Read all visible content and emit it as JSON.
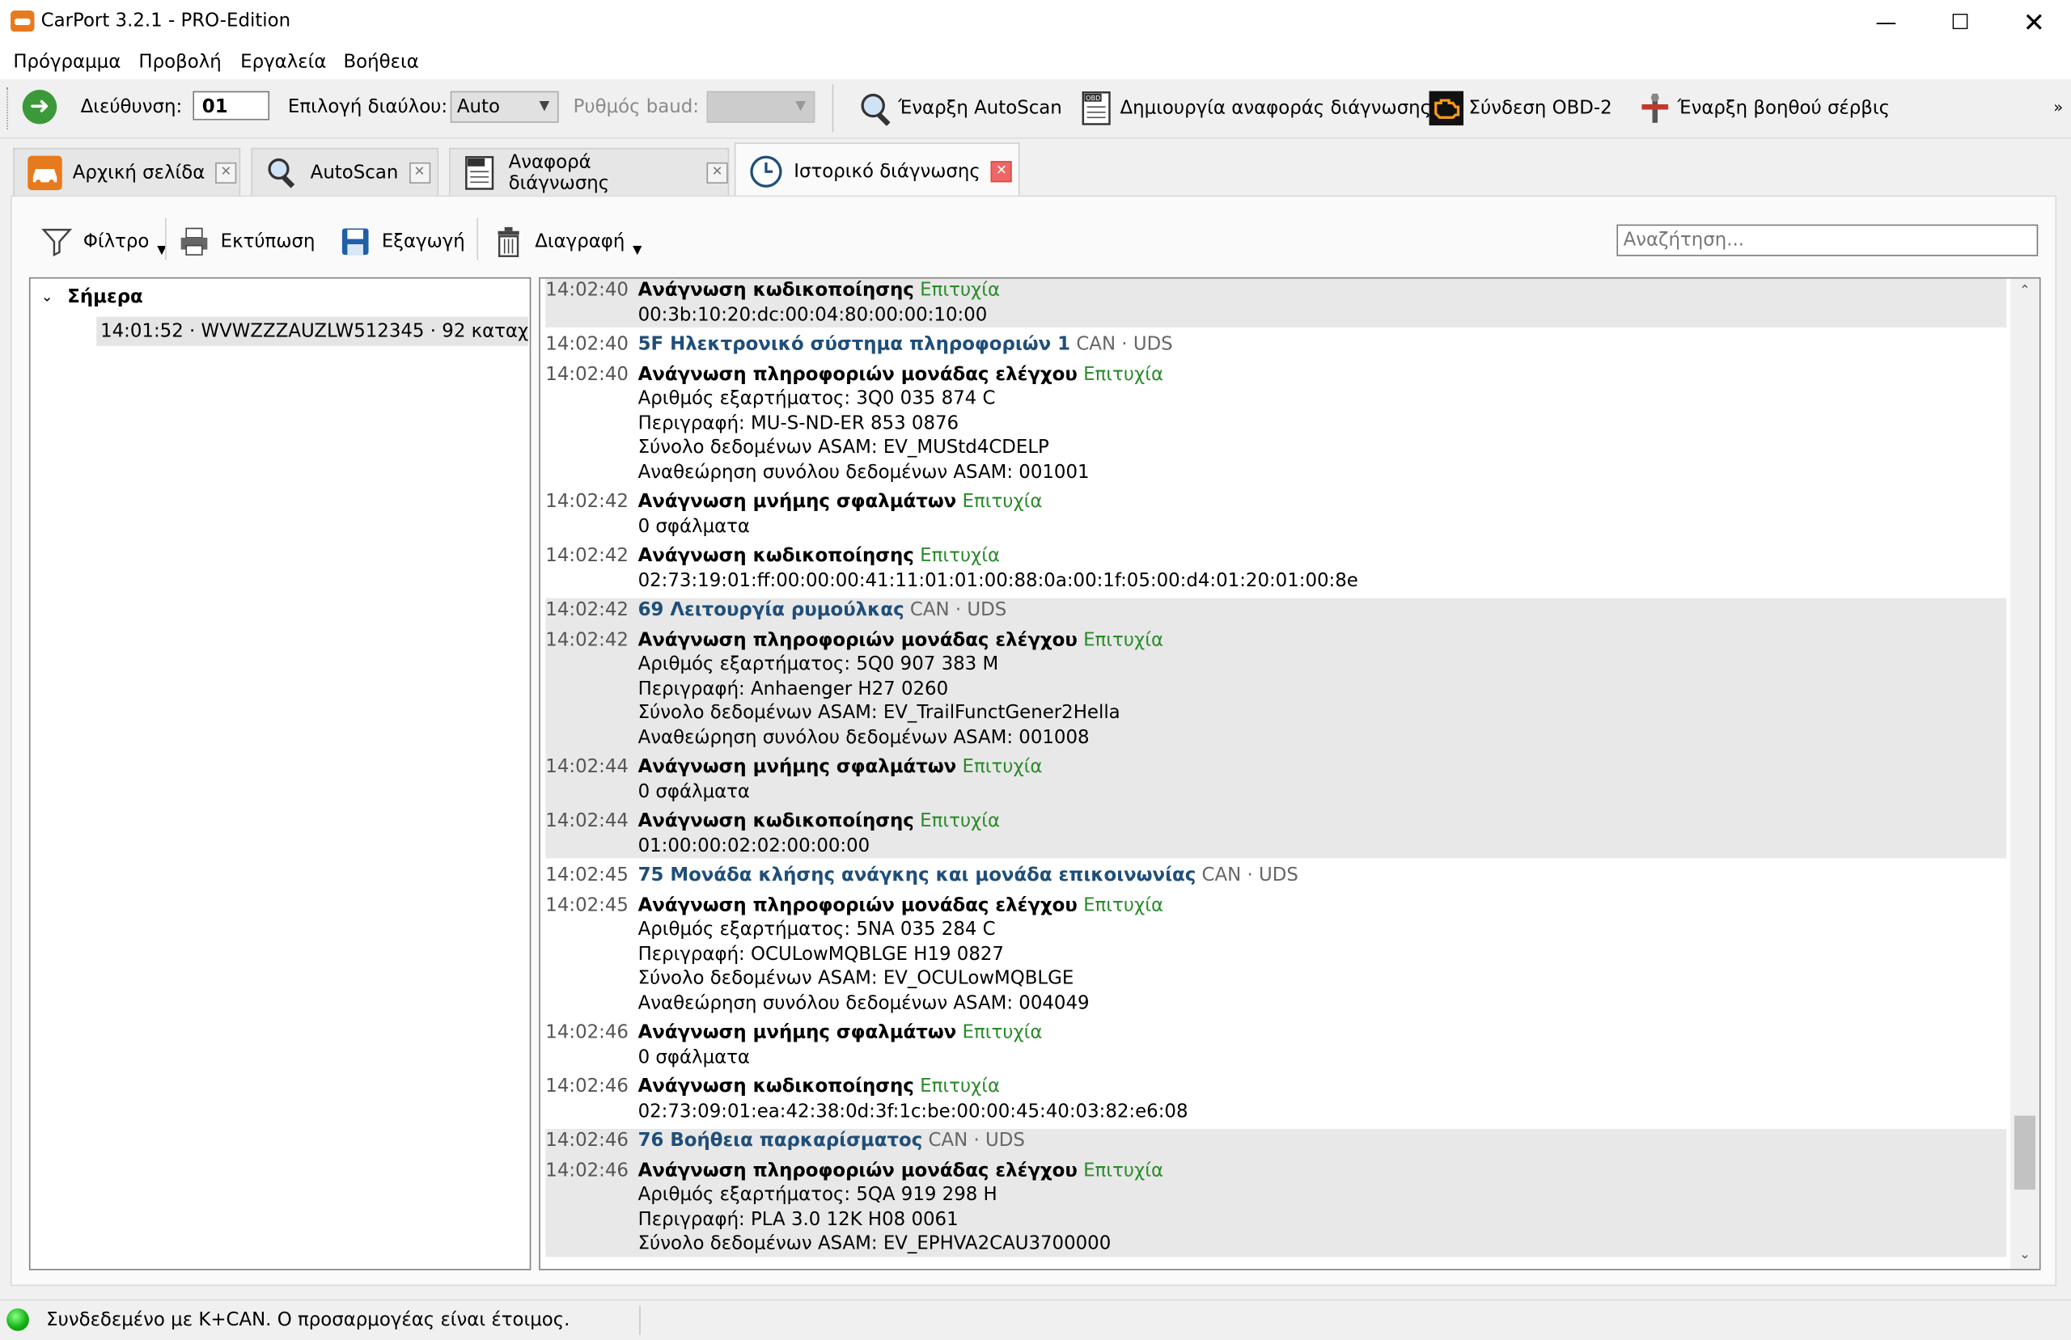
{
  "window": {
    "title": "CarPort 3.2.1 - PRO-Edition"
  },
  "menu": [
    "Πρόγραμμα",
    "Προβολή",
    "Εργαλεία",
    "Βοήθεια"
  ],
  "toolbar": {
    "address_label": "Διεύθυνση:",
    "address_value": "01",
    "bus_label": "Επιλογή διαύλου:",
    "bus_value": "Auto",
    "baud_label": "Ρυθμός baud:",
    "autoscan": "Έναρξη AutoScan",
    "report": "Δημιουργία αναφοράς διάγνωσης",
    "obd": "Σύνδεση OBD-2",
    "service": "Έναρξη βοηθού σέρβις",
    "overflow": "»"
  },
  "tabs": [
    {
      "label": "Αρχική σελίδα"
    },
    {
      "label": "AutoScan"
    },
    {
      "label": "Αναφορά διάγνωσης"
    },
    {
      "label": "Ιστορικό διάγνωσης"
    }
  ],
  "history_toolbar": {
    "filter": "Φίλτρο",
    "print": "Εκτύπωση",
    "export": "Εξαγωγή",
    "delete": "Διαγραφή",
    "search_placeholder": "Αναζήτηση..."
  },
  "tree": {
    "group": "Σήμερα",
    "item": "14:01:52 · WVWZZZAUZLW512345 · 92 καταχ..."
  },
  "log": [
    {
      "shade": true,
      "rows": [
        {
          "time": "14:02:40",
          "op": "Ανάγνωση κωδικοποίησης",
          "status": "Επιτυχία",
          "lines": [
            "00:3b:10:20:dc:00:04:80:00:00:10:00"
          ]
        }
      ]
    },
    {
      "shade": false,
      "rows": [
        {
          "time": "14:02:40",
          "module": "5F Ηλεκτρονικό σύστημα πληροφοριών 1",
          "proto": "CAN · UDS"
        },
        {
          "time": "14:02:40",
          "op": "Ανάγνωση πληροφοριών μονάδας ελέγχου",
          "status": "Επιτυχία",
          "lines": [
            "Αριθμός εξαρτήματος: 3Q0 035 874 C",
            "Περιγραφή: MU-S-ND-ER 853 0876",
            "Σύνολο δεδομένων ASAM: EV_MUStd4CDELP",
            "Αναθεώρηση συνόλου δεδομένων ASAM: 001001"
          ]
        },
        {
          "time": "14:02:42",
          "op": "Ανάγνωση μνήμης σφαλμάτων",
          "status": "Επιτυχία",
          "lines": [
            "0 σφάλματα"
          ]
        },
        {
          "time": "14:02:42",
          "op": "Ανάγνωση κωδικοποίησης",
          "status": "Επιτυχία",
          "lines": [
            "02:73:19:01:ff:00:00:00:41:11:01:01:00:88:0a:00:1f:05:00:d4:01:20:01:00:8e"
          ]
        }
      ]
    },
    {
      "shade": true,
      "rows": [
        {
          "time": "14:02:42",
          "module": "69 Λειτουργία ρυμούλκας",
          "proto": "CAN · UDS"
        },
        {
          "time": "14:02:42",
          "op": "Ανάγνωση πληροφοριών μονάδας ελέγχου",
          "status": "Επιτυχία",
          "lines": [
            "Αριθμός εξαρτήματος: 5Q0 907 383 M",
            "Περιγραφή: Anhaenger H27 0260",
            "Σύνολο δεδομένων ASAM: EV_TrailFunctGener2Hella",
            "Αναθεώρηση συνόλου δεδομένων ASAM: 001008"
          ]
        },
        {
          "time": "14:02:44",
          "op": "Ανάγνωση μνήμης σφαλμάτων",
          "status": "Επιτυχία",
          "lines": [
            "0 σφάλματα"
          ]
        },
        {
          "time": "14:02:44",
          "op": "Ανάγνωση κωδικοποίησης",
          "status": "Επιτυχία",
          "lines": [
            "01:00:00:02:02:00:00:00"
          ]
        }
      ]
    },
    {
      "shade": false,
      "rows": [
        {
          "time": "14:02:45",
          "module": "75 Μονάδα κλήσης ανάγκης και μονάδα επικοινωνίας",
          "proto": "CAN · UDS"
        },
        {
          "time": "14:02:45",
          "op": "Ανάγνωση πληροφοριών μονάδας ελέγχου",
          "status": "Επιτυχία",
          "lines": [
            "Αριθμός εξαρτήματος: 5NA 035 284 C",
            "Περιγραφή: OCULowMQBLGE H19 0827",
            "Σύνολο δεδομένων ASAM: EV_OCULowMQBLGE",
            "Αναθεώρηση συνόλου δεδομένων ASAM: 004049"
          ]
        },
        {
          "time": "14:02:46",
          "op": "Ανάγνωση μνήμης σφαλμάτων",
          "status": "Επιτυχία",
          "lines": [
            "0 σφάλματα"
          ]
        },
        {
          "time": "14:02:46",
          "op": "Ανάγνωση κωδικοποίησης",
          "status": "Επιτυχία",
          "lines": [
            "02:73:09:01:ea:42:38:0d:3f:1c:be:00:00:45:40:03:82:e6:08"
          ]
        }
      ]
    },
    {
      "shade": true,
      "rows": [
        {
          "time": "14:02:46",
          "module": "76 Βοήθεια παρκαρίσματος",
          "proto": "CAN · UDS"
        },
        {
          "time": "14:02:46",
          "op": "Ανάγνωση πληροφοριών μονάδας ελέγχου",
          "status": "Επιτυχία",
          "lines": [
            "Αριθμός εξαρτήματος: 5QA 919 298 H",
            "Περιγραφή: PLA 3.0 12K H08 0061",
            "Σύνολο δεδομένων ASAM: EV_EPHVA2CAU3700000"
          ]
        }
      ]
    }
  ],
  "status": {
    "text": "Συνδεδεμένο με K+CAN. Ο προσαρμογέας είναι έτοιμος."
  }
}
